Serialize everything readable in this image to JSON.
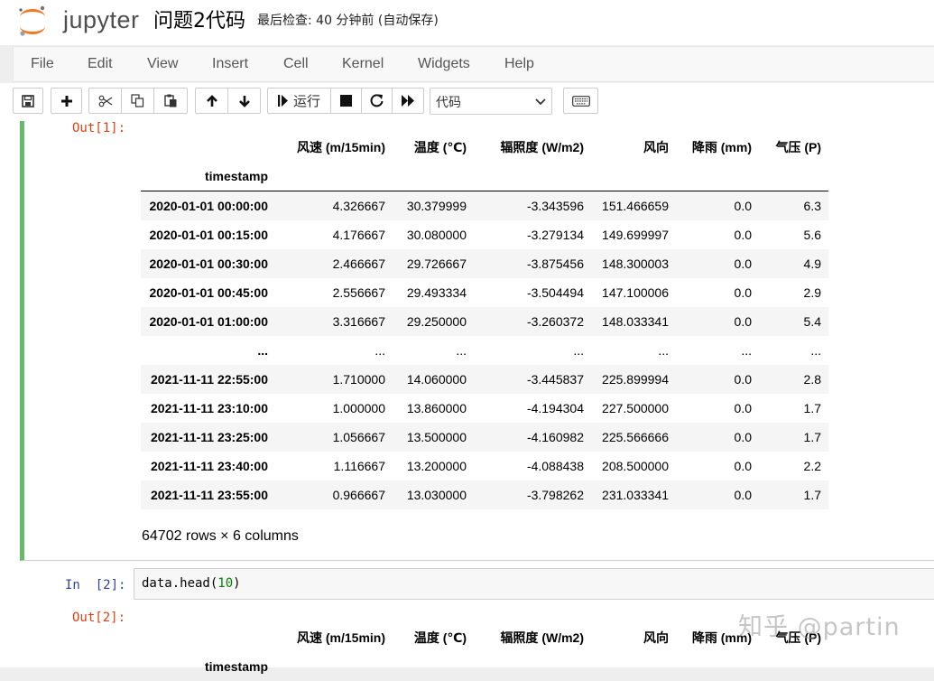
{
  "header": {
    "logo_text": "jupyter",
    "notebook_name": "问题2代码",
    "checkpoint": "最后检查: 40 分钟前  (自动保存)"
  },
  "menubar": {
    "items": [
      "File",
      "Edit",
      "View",
      "Insert",
      "Cell",
      "Kernel",
      "Widgets",
      "Help"
    ]
  },
  "toolbar": {
    "run_label": "运行",
    "cell_type": "代码",
    "cell_type_options": [
      "代码"
    ]
  },
  "cell1": {
    "out_prompt": "Out[1]:",
    "columns": [
      "风速 (m/15min)",
      "温度 (℃)",
      "辐照度 (W/m2)",
      "风向",
      "降雨 (mm)",
      "气压 (P)"
    ],
    "index_name": "timestamp",
    "rows": [
      [
        "2020-01-01 00:00:00",
        "4.326667",
        "30.379999",
        "-3.343596",
        "151.466659",
        "0.0",
        "6.3"
      ],
      [
        "2020-01-01 00:15:00",
        "4.176667",
        "30.080000",
        "-3.279134",
        "149.699997",
        "0.0",
        "5.6"
      ],
      [
        "2020-01-01 00:30:00",
        "2.466667",
        "29.726667",
        "-3.875456",
        "148.300003",
        "0.0",
        "4.9"
      ],
      [
        "2020-01-01 00:45:00",
        "2.556667",
        "29.493334",
        "-3.504494",
        "147.100006",
        "0.0",
        "2.9"
      ],
      [
        "2020-01-01 01:00:00",
        "3.316667",
        "29.250000",
        "-3.260372",
        "148.033341",
        "0.0",
        "5.4"
      ],
      [
        "...",
        "...",
        "...",
        "...",
        "...",
        "...",
        "..."
      ],
      [
        "2021-11-11 22:55:00",
        "1.710000",
        "14.060000",
        "-3.445837",
        "225.899994",
        "0.0",
        "2.8"
      ],
      [
        "2021-11-11 23:10:00",
        "1.000000",
        "13.860000",
        "-4.194304",
        "227.500000",
        "0.0",
        "1.7"
      ],
      [
        "2021-11-11 23:25:00",
        "1.056667",
        "13.500000",
        "-4.160982",
        "225.566666",
        "0.0",
        "1.7"
      ],
      [
        "2021-11-11 23:40:00",
        "1.116667",
        "13.200000",
        "-4.088438",
        "208.500000",
        "0.0",
        "2.2"
      ],
      [
        "2021-11-11 23:55:00",
        "0.966667",
        "13.030000",
        "-3.798262",
        "231.033341",
        "0.0",
        "1.7"
      ]
    ],
    "summary": "64702 rows × 6 columns"
  },
  "cell2": {
    "in_prompt": "In  [2]:",
    "code_prefix": "data.head(",
    "code_arg": "10",
    "code_suffix": ")",
    "out_prompt": "Out[2]:",
    "columns": [
      "风速 (m/15min)",
      "温度 (℃)",
      "辐照度 (W/m2)",
      "风向",
      "降雨 (mm)",
      "气压 (P)"
    ],
    "index_name": "timestamp"
  },
  "watermark": "知乎 @partin"
}
